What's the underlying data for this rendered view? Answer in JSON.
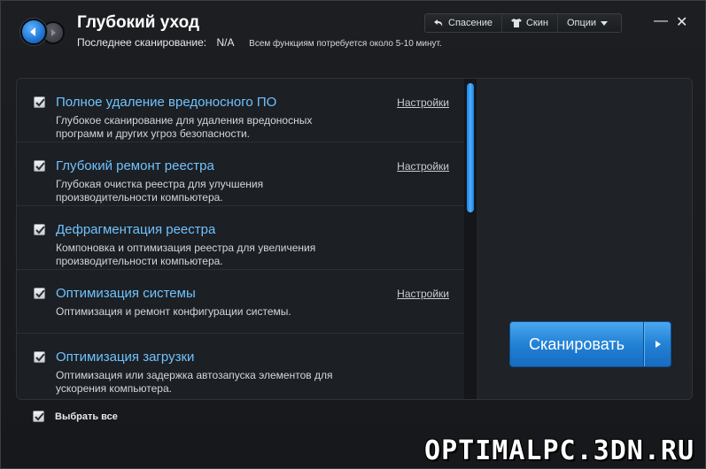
{
  "header": {
    "title": "Глубокий уход",
    "last_scan_label": "Последнее сканирование:",
    "last_scan_value": "N/A",
    "time_note": "Всем функциям потребуется около 5-10 минут."
  },
  "topbar": {
    "rescue": "Спасение",
    "skin": "Скин",
    "options": "Опции"
  },
  "window_controls": {
    "minimize": "—",
    "close": "✕"
  },
  "items": [
    {
      "name": "Полное удаление вредоносного ПО",
      "settings": "Настройки",
      "desc": "Глубокое сканирование для удаления вредоносных программ и других угроз безопасности.",
      "checked": true
    },
    {
      "name": "Глубокий ремонт реестра",
      "settings": "Настройки",
      "desc": "Глубокая очистка реестра для улучшения производительности компьютера.",
      "checked": true
    },
    {
      "name": "Дефрагментация реестра",
      "settings": "",
      "desc": "Компоновка и оптимизация реестра для увеличения производительности компьютера.",
      "checked": true
    },
    {
      "name": "Оптимизация системы",
      "settings": "Настройки",
      "desc": "Оптимизация и ремонт конфигурации системы.",
      "checked": true
    },
    {
      "name": "Оптимизация загрузки",
      "settings": "",
      "desc": "Оптимизация или задержка автозапуска элементов для ускорения компьютера.",
      "checked": true
    }
  ],
  "scan_button": {
    "label": "Сканировать"
  },
  "select_all": {
    "label": "Выбрать все",
    "checked": true
  },
  "watermark": "OPTIMALPC.3DN.RU",
  "colors": {
    "accent": "#2381d6",
    "item_title": "#6fc2ff"
  }
}
